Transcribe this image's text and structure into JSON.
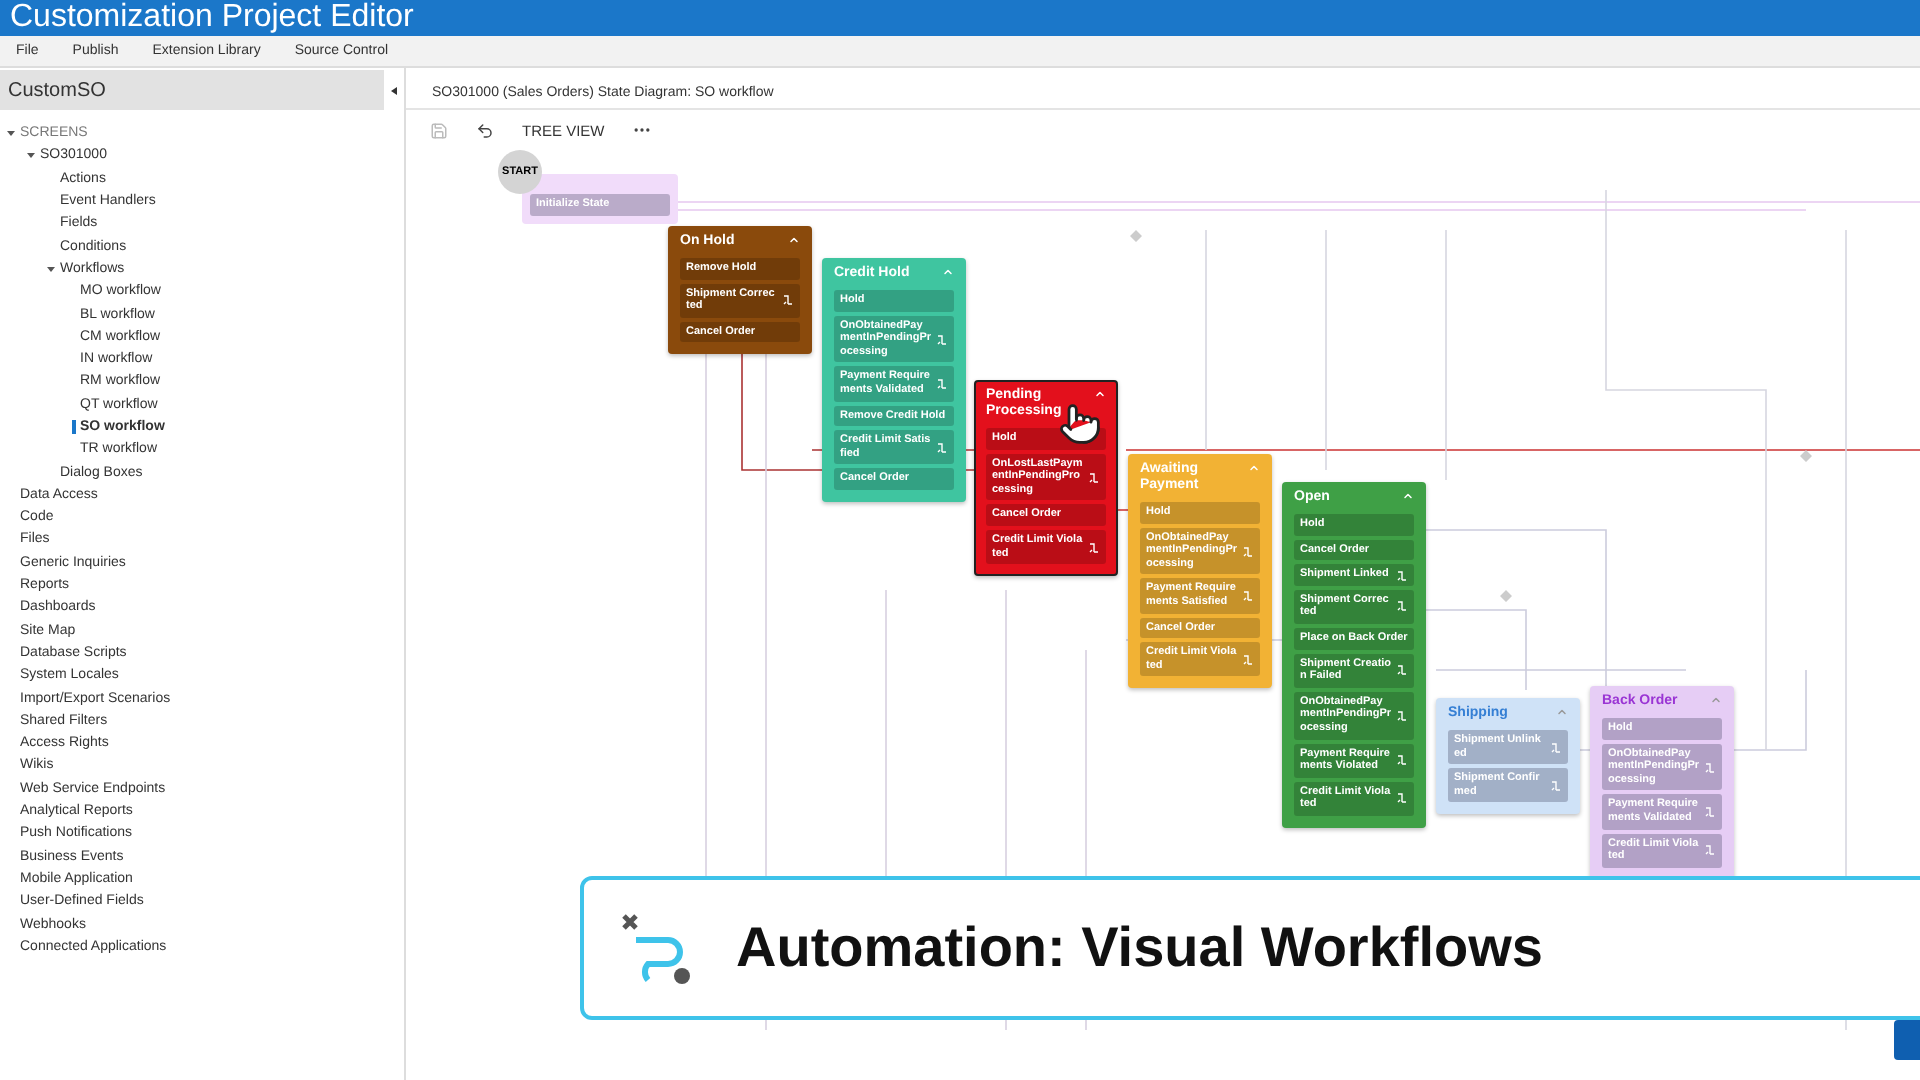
{
  "window": {
    "title": "Customization Project Editor"
  },
  "menu": [
    "File",
    "Publish",
    "Extension Library",
    "Source Control"
  ],
  "sidebar": {
    "project": "CustomSO",
    "tree": [
      {
        "label": "SCREENS",
        "expanded": true,
        "selected": false,
        "children": [
          {
            "label": "SO301000",
            "expanded": true,
            "selected": false,
            "children": [
              {
                "label": "Actions",
                "selected": false
              },
              {
                "label": "Event Handlers",
                "selected": false
              },
              {
                "label": "Fields",
                "selected": false
              },
              {
                "label": "Conditions",
                "selected": false
              },
              {
                "label": "Workflows",
                "expanded": true,
                "selected": false,
                "children": [
                  {
                    "label": "MO workflow",
                    "selected": false
                  },
                  {
                    "label": "BL workflow",
                    "selected": false
                  },
                  {
                    "label": "CM workflow",
                    "selected": false
                  },
                  {
                    "label": "IN workflow",
                    "selected": false
                  },
                  {
                    "label": "RM workflow",
                    "selected": false
                  },
                  {
                    "label": "QT workflow",
                    "selected": false
                  },
                  {
                    "label": "SO workflow",
                    "selected": true
                  },
                  {
                    "label": "TR workflow",
                    "selected": false
                  }
                ]
              },
              {
                "label": "Dialog Boxes",
                "selected": false
              }
            ]
          }
        ]
      },
      {
        "label": "Data Access",
        "selected": false
      },
      {
        "label": "Code",
        "selected": false
      },
      {
        "label": "Files",
        "selected": false
      },
      {
        "label": "Generic Inquiries",
        "selected": false
      },
      {
        "label": "Reports",
        "selected": false
      },
      {
        "label": "Dashboards",
        "selected": false
      },
      {
        "label": "Site Map",
        "selected": false
      },
      {
        "label": "Database Scripts",
        "selected": false
      },
      {
        "label": "System Locales",
        "selected": false
      },
      {
        "label": "Import/Export Scenarios",
        "selected": false
      },
      {
        "label": "Shared Filters",
        "selected": false
      },
      {
        "label": "Access Rights",
        "selected": false
      },
      {
        "label": "Wikis",
        "selected": false
      },
      {
        "label": "Web Service Endpoints",
        "selected": false
      },
      {
        "label": "Analytical Reports",
        "selected": false
      },
      {
        "label": "Push Notifications",
        "selected": false
      },
      {
        "label": "Business Events",
        "selected": false
      },
      {
        "label": "Mobile Application",
        "selected": false
      },
      {
        "label": "User-Defined Fields",
        "selected": false
      },
      {
        "label": "Webhooks",
        "selected": false
      },
      {
        "label": "Connected Applications",
        "selected": false
      }
    ]
  },
  "diagram": {
    "header": "SO301000 (Sales Orders) State Diagram: SO workflow",
    "toolbar": {
      "view_button": "TREE VIEW"
    },
    "start_label": "START",
    "initial": {
      "action": "Initialize State"
    },
    "states": [
      {
        "title": "On Hold",
        "color": "#8a4a0c",
        "kind": "solid",
        "selected": false,
        "actions": [
          {
            "label": "Remove Hold",
            "has_icon": false
          },
          {
            "label": "Shipment Corrected",
            "has_icon": true
          },
          {
            "label": "Cancel Order",
            "has_icon": false
          }
        ]
      },
      {
        "title": "Credit Hold",
        "color": "#3fc5a0",
        "kind": "solid",
        "selected": false,
        "actions": [
          {
            "label": "Hold",
            "has_icon": false
          },
          {
            "label": "OnObtainedPaymentInPendingProcessing",
            "has_icon": true
          },
          {
            "label": "Payment Requirements Validated",
            "has_icon": true
          },
          {
            "label": "Remove Credit Hold",
            "has_icon": false
          },
          {
            "label": "Credit Limit Satisfied",
            "has_icon": true
          },
          {
            "label": "Cancel Order",
            "has_icon": false
          }
        ]
      },
      {
        "title": "Pending Processing",
        "color": "#e3101c",
        "kind": "solid",
        "selected": true,
        "actions": [
          {
            "label": "Hold",
            "has_icon": false
          },
          {
            "label": "OnLostLastPaymentInPendingProcessing",
            "has_icon": true
          },
          {
            "label": "Cancel Order",
            "has_icon": false
          },
          {
            "label": "Credit Limit Violated",
            "has_icon": true
          }
        ]
      },
      {
        "title": "Awaiting Payment",
        "color": "#f2b234",
        "kind": "solid",
        "selected": false,
        "actions": [
          {
            "label": "Hold",
            "has_icon": false
          },
          {
            "label": "OnObtainedPaymentInPendingProcessing",
            "has_icon": true
          },
          {
            "label": "Payment Requirements Satisfied",
            "has_icon": true
          },
          {
            "label": "Cancel Order",
            "has_icon": false
          },
          {
            "label": "Credit Limit Violated",
            "has_icon": true
          }
        ]
      },
      {
        "title": "Open",
        "color": "#3fa046",
        "kind": "solid",
        "selected": false,
        "actions": [
          {
            "label": "Hold",
            "has_icon": false
          },
          {
            "label": "Cancel Order",
            "has_icon": false
          },
          {
            "label": "Shipment Linked",
            "has_icon": true
          },
          {
            "label": "Shipment Corrected",
            "has_icon": true
          },
          {
            "label": "Place on Back Order",
            "has_icon": false
          },
          {
            "label": "Shipment Creation Failed",
            "has_icon": true
          },
          {
            "label": "OnObtainedPaymentInPendingProcessing",
            "has_icon": true
          },
          {
            "label": "Payment Requirements Violated",
            "has_icon": true
          },
          {
            "label": "Credit Limit Violated",
            "has_icon": true
          }
        ]
      },
      {
        "title": "Shipping",
        "color": "#cfe2f7",
        "kind": "pale",
        "selected": false,
        "actions": [
          {
            "label": "Shipment Unlinked",
            "has_icon": true
          },
          {
            "label": "Shipment Confirmed",
            "has_icon": true
          }
        ]
      },
      {
        "title": "Back Order",
        "color": "#e6cdf5",
        "kind": "pale",
        "selected": false,
        "actions": [
          {
            "label": "Hold",
            "has_icon": false
          },
          {
            "label": "OnObtainedPaymentInPendingProcessing",
            "has_icon": true
          },
          {
            "label": "Payment Requirements Validated",
            "has_icon": true
          },
          {
            "label": "Credit Limit Violated",
            "has_icon": true
          }
        ]
      }
    ]
  },
  "banner": {
    "title": "Automation: Visual Workflows"
  }
}
